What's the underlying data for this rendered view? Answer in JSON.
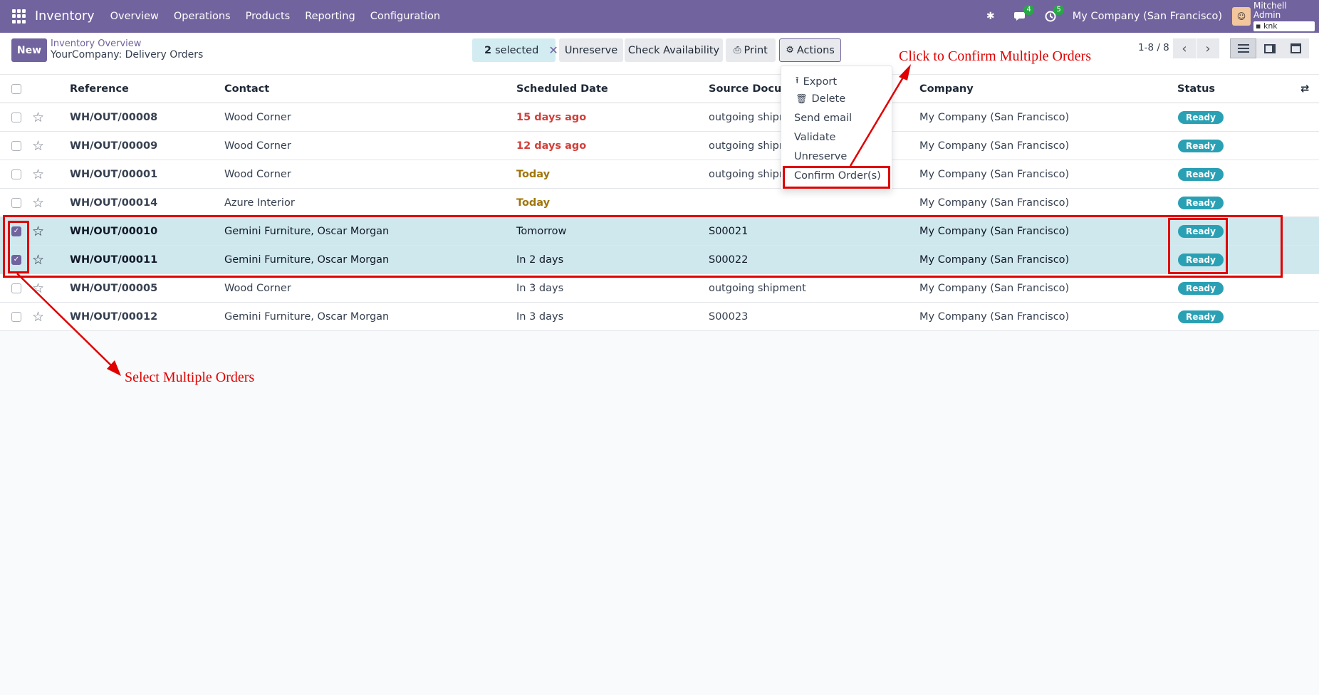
{
  "navbar": {
    "app_name": "Inventory",
    "menu": [
      "Overview",
      "Operations",
      "Products",
      "Reporting",
      "Configuration"
    ],
    "messages_count": "4",
    "activities_count": "5",
    "company": "My Company (San Francisco)",
    "user_name": "Mitchell Admin",
    "database": "knk"
  },
  "control": {
    "new_label": "New",
    "breadcrumb_parent": "Inventory Overview",
    "breadcrumb_current": "YourCompany: Delivery Orders",
    "selected_count": "2",
    "selected_label": "selected",
    "unreserve_label": "Unreserve",
    "check_availability_label": "Check Availability",
    "print_label": "Print",
    "actions_label": "Actions",
    "pager": "1-8 / 8"
  },
  "actions_menu": {
    "items": [
      "Export",
      "Delete",
      "Send email",
      "Validate",
      "Unreserve",
      "Confirm Order(s)"
    ]
  },
  "table": {
    "headers": [
      "Reference",
      "Contact",
      "Scheduled Date",
      "Source Docume",
      "Company",
      "Status"
    ],
    "rows": [
      {
        "ref": "WH/OUT/00008",
        "contact": "Wood Corner",
        "date": "15 days ago",
        "date_style": "late",
        "source": "outgoing shipm",
        "company": "My Company (San Francisco)",
        "status": "Ready",
        "selected": false
      },
      {
        "ref": "WH/OUT/00009",
        "contact": "Wood Corner",
        "date": "12 days ago",
        "date_style": "late",
        "source": "outgoing shipm",
        "company": "My Company (San Francisco)",
        "status": "Ready",
        "selected": false
      },
      {
        "ref": "WH/OUT/00001",
        "contact": "Wood Corner",
        "date": "Today",
        "date_style": "today",
        "source": "outgoing shipm",
        "company": "My Company (San Francisco)",
        "status": "Ready",
        "selected": false
      },
      {
        "ref": "WH/OUT/00014",
        "contact": "Azure Interior",
        "date": "Today",
        "date_style": "today",
        "source": "",
        "company": "My Company (San Francisco)",
        "status": "Ready",
        "selected": false
      },
      {
        "ref": "WH/OUT/00010",
        "contact": "Gemini Furniture, Oscar Morgan",
        "date": "Tomorrow",
        "date_style": "normal",
        "source": "S00021",
        "company": "My Company (San Francisco)",
        "status": "Ready",
        "selected": true
      },
      {
        "ref": "WH/OUT/00011",
        "contact": "Gemini Furniture, Oscar Morgan",
        "date": "In 2 days",
        "date_style": "normal",
        "source": "S00022",
        "company": "My Company (San Francisco)",
        "status": "Ready",
        "selected": true
      },
      {
        "ref": "WH/OUT/00005",
        "contact": "Wood Corner",
        "date": "In 3 days",
        "date_style": "normal",
        "source": "outgoing shipment",
        "company": "My Company (San Francisco)",
        "status": "Ready",
        "selected": false
      },
      {
        "ref": "WH/OUT/00012",
        "contact": "Gemini Furniture, Oscar Morgan",
        "date": "In 3 days",
        "date_style": "normal",
        "source": "S00023",
        "company": "My Company (San Francisco)",
        "status": "Ready",
        "selected": false
      }
    ]
  },
  "annotations": {
    "confirm_hint": "Click to Confirm Multiple Orders",
    "select_hint": "Select Multiple Orders"
  },
  "colors": {
    "brand": "#71639e",
    "selected_row": "#cfe8ee",
    "status_ready": "#2aa0b4",
    "annotation": "#e00000"
  }
}
